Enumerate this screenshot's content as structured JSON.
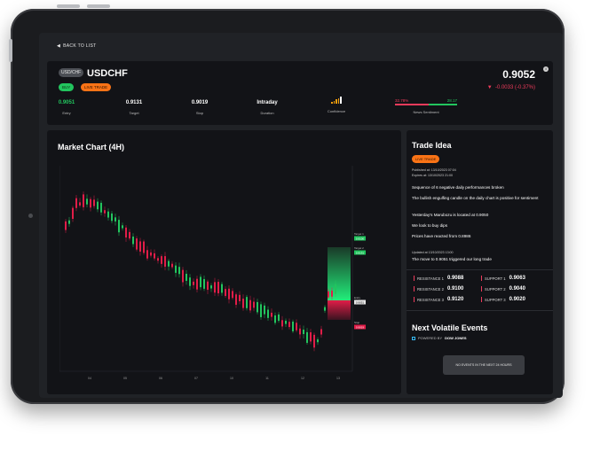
{
  "nav": {
    "back_label": "BACK TO LIST"
  },
  "header": {
    "symbol_pill": "USD/CHF",
    "symbol": "USDCHF",
    "direction": "BUY",
    "status": "LIVE TRADE",
    "price": "0.9052",
    "change": "-0.0033 (-0.37%)",
    "stats": [
      {
        "value": "0.9051",
        "label": "Entry",
        "color": "#22c55e"
      },
      {
        "value": "0.9131",
        "label": "Target",
        "color": "#ffffff"
      },
      {
        "value": "0.9019",
        "label": "Stop",
        "color": "#ffffff"
      },
      {
        "value": "Intraday",
        "label": "Duration",
        "color": "#ffffff"
      }
    ],
    "confidence_label": "Confidence",
    "sentiment": {
      "bear": "32.78%",
      "bull": "28.17",
      "label": "News Sentiment",
      "bear_color": "#ef3b5b",
      "bull_color": "#22c55e"
    }
  },
  "chart": {
    "title": "Market Chart (4H)",
    "x_ticks": [
      "04",
      "05",
      "06",
      "07",
      "10",
      "11",
      "12",
      "13"
    ],
    "markers": [
      {
        "label": "Target 1",
        "value": "0.9100",
        "color": "#22c55e"
      },
      {
        "label": "Target 2",
        "value": "0.9131",
        "color": "#22c55e"
      },
      {
        "label": "Entry",
        "value": "0.9051",
        "color": "#e5e5e5"
      },
      {
        "label": "Stop",
        "value": "0.9019",
        "color": "#e11d48"
      }
    ]
  },
  "trade_idea": {
    "title": "Trade Idea",
    "status": "LIVE TRADE",
    "published": "Published at: 13/10/2023 07:04",
    "expires": "Expires at: 13/10/2023 21:00",
    "points": [
      "Sequence of 6 negative daily performances broken",
      "The bullish engulfing candle on the daily chart is positive for sentiment",
      "Yesterday's Marubozu is located at 0.9050",
      "We look to buy dips",
      "Prices have reacted from 0.8986"
    ],
    "updated": "Updated at 13/10/2023 13:00",
    "update_text": "The move to 0.9051 triggered our long trade",
    "resistance": [
      {
        "label": "RESISTANCE 1",
        "value": "0.9088"
      },
      {
        "label": "RESISTANCE 2",
        "value": "0.9100"
      },
      {
        "label": "RESISTANCE 3",
        "value": "0.9120"
      }
    ],
    "support": [
      {
        "label": "SUPPORT 1",
        "value": "0.9063"
      },
      {
        "label": "SUPPORT 2",
        "value": "0.9040"
      },
      {
        "label": "SUPPORT 3",
        "value": "0.9020"
      }
    ],
    "resistance_color": "#ef3b5b",
    "support_color": "#ef3b5b"
  },
  "events": {
    "title": "Next Volatile Events",
    "powered_prefix": "POWERED BY",
    "powered_by": "DOW JONES",
    "empty_text": "NO EVENTS IN THE NEXT 24 HOURS"
  }
}
